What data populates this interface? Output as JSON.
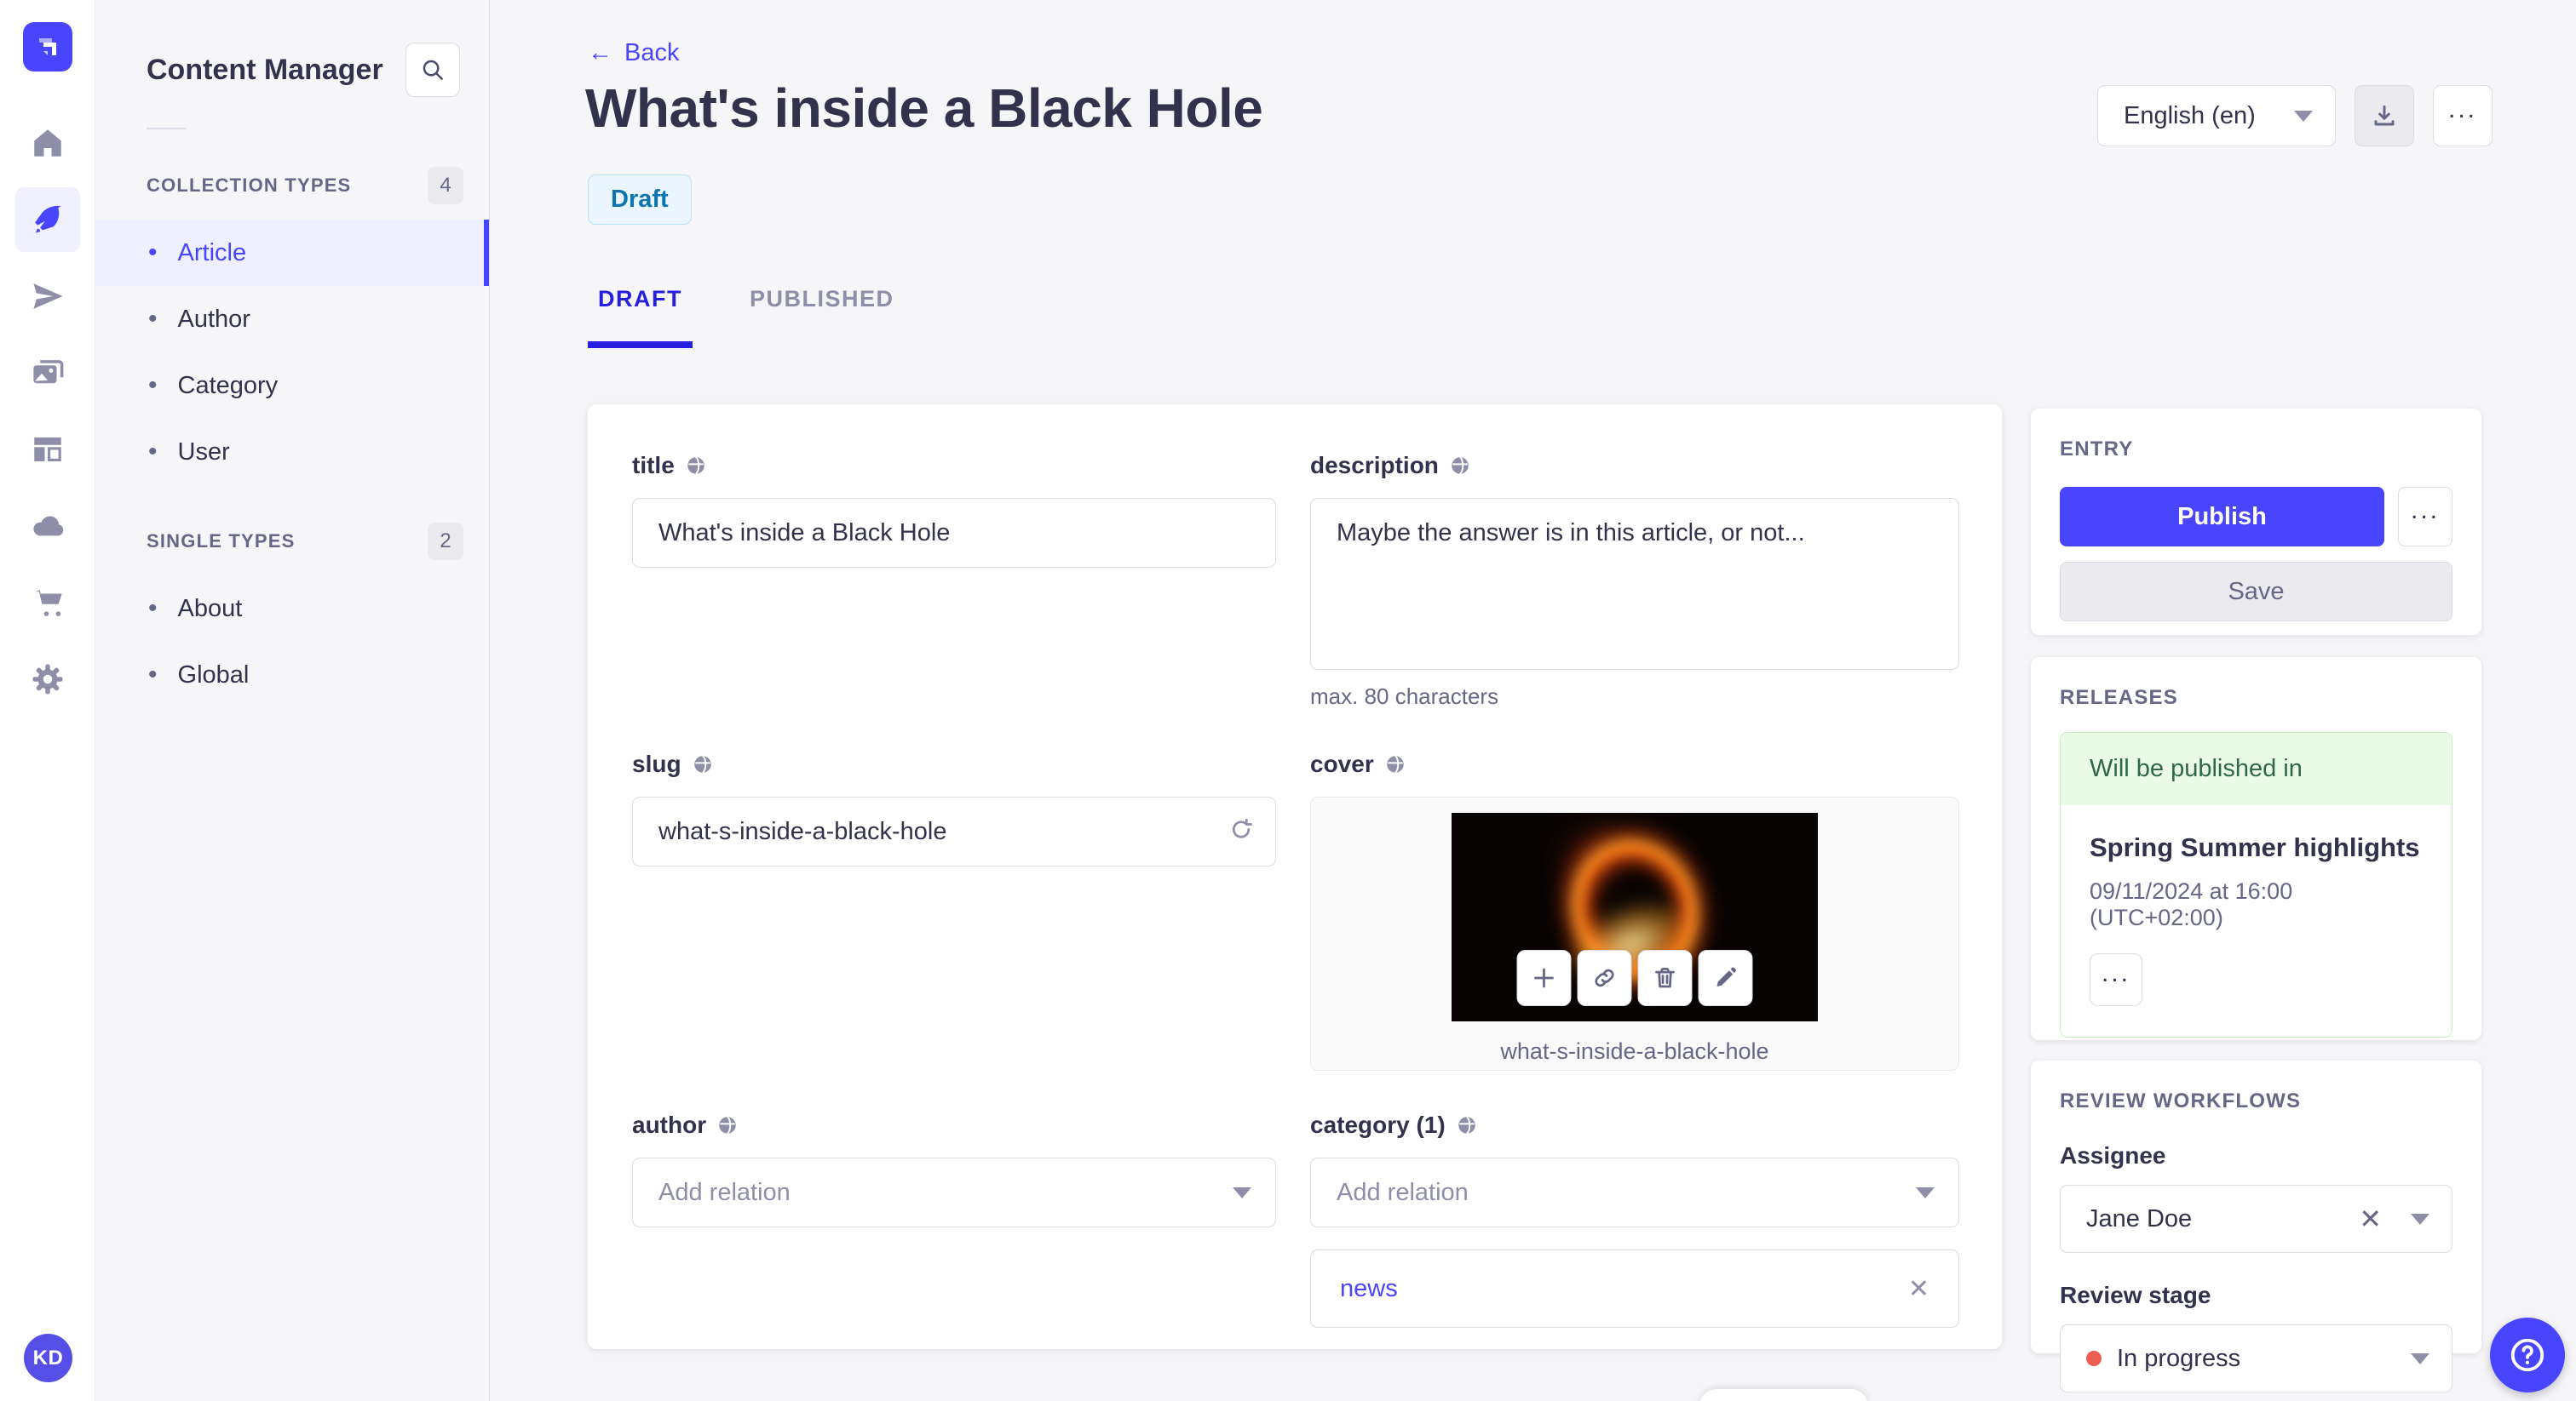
{
  "colors": {
    "primary": "#4945ff",
    "primary_dark": "#271fe0",
    "draft_text": "#0c75af",
    "success_text": "#2f6846",
    "danger_dot": "#ee5e52"
  },
  "nav_rail": {
    "avatar_initials": "KD",
    "items": [
      {
        "name": "home",
        "active": false
      },
      {
        "name": "content-manager",
        "active": true
      },
      {
        "name": "releases",
        "active": false
      },
      {
        "name": "media-library",
        "active": false
      },
      {
        "name": "content-type-builder",
        "active": false
      },
      {
        "name": "deploy",
        "active": false
      },
      {
        "name": "marketplace",
        "active": false
      },
      {
        "name": "settings",
        "active": false
      }
    ]
  },
  "sidebar": {
    "title": "Content Manager",
    "sections": [
      {
        "label": "COLLECTION TYPES",
        "count": "4",
        "items": [
          {
            "label": "Article"
          },
          {
            "label": "Author"
          },
          {
            "label": "Category"
          },
          {
            "label": "User"
          }
        ]
      },
      {
        "label": "SINGLE TYPES",
        "count": "2",
        "items": [
          {
            "label": "About"
          },
          {
            "label": "Global"
          }
        ]
      }
    ]
  },
  "header": {
    "back_label": "Back",
    "title": "What's inside a Black Hole",
    "status_badge": "Draft",
    "language": "English (en)"
  },
  "tabs": {
    "draft": "DRAFT",
    "published": "PUBLISHED"
  },
  "form": {
    "title": {
      "label": "title",
      "value": "What's inside a Black Hole"
    },
    "description": {
      "label": "description",
      "value": "Maybe the answer is in this article, or not...",
      "hint": "max. 80 characters"
    },
    "slug": {
      "label": "slug",
      "value": "what-s-inside-a-black-hole"
    },
    "cover": {
      "label": "cover",
      "caption": "what-s-inside-a-black-hole"
    },
    "author": {
      "label": "author",
      "placeholder": "Add relation"
    },
    "category": {
      "label": "category (1)",
      "placeholder": "Add relation",
      "relation": "news"
    }
  },
  "entry_panel": {
    "label": "ENTRY",
    "publish_label": "Publish",
    "save_label": "Save"
  },
  "releases_panel": {
    "label": "RELEASES",
    "status": "Will be published in",
    "release_title": "Spring Summer highlights",
    "release_date": "09/11/2024 at 16:00 (UTC+02:00)"
  },
  "review_panel": {
    "label": "REVIEW WORKFLOWS",
    "assignee_label": "Assignee",
    "assignee_value": "Jane Doe",
    "stage_label": "Review stage",
    "stage_value": "In progress"
  }
}
